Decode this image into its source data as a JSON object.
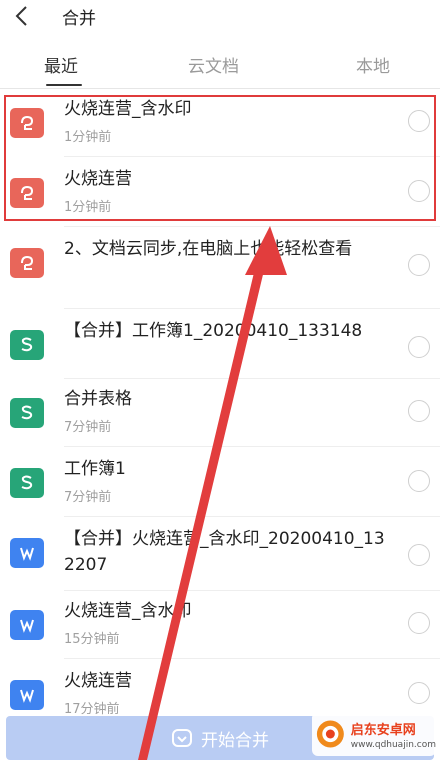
{
  "header": {
    "title": "合并",
    "back_icon": "chevron-left-icon"
  },
  "tabs": [
    {
      "label": "最近",
      "active": true
    },
    {
      "label": "云文档",
      "active": false
    },
    {
      "label": "本地",
      "active": false
    }
  ],
  "files": [
    {
      "name": "火烧连营_含水印",
      "time": "1分钟前",
      "type": "pdf"
    },
    {
      "name": "火烧连营",
      "time": "1分钟前",
      "type": "pdf"
    },
    {
      "name": "2、文档云同步,在电脑上也能轻松查看",
      "time": "",
      "type": "pdf"
    },
    {
      "name": "【合并】工作簿1_20200410_133148",
      "time": "",
      "type": "sheet"
    },
    {
      "name": "合并表格",
      "time": "7分钟前",
      "type": "sheet"
    },
    {
      "name": "工作簿1",
      "time": "7分钟前",
      "type": "sheet"
    },
    {
      "name": "【合并】火烧连营_含水印_20200410_132207",
      "time": "",
      "type": "doc"
    },
    {
      "name": "火烧连营_含水印",
      "time": "15分钟前",
      "type": "doc"
    },
    {
      "name": "火烧连营",
      "time": "17分钟前",
      "type": "doc"
    }
  ],
  "bottom": {
    "button_label": "开始合并"
  },
  "watermark": {
    "name": "启东安卓网",
    "url": "www.qdhuajin.com"
  },
  "colors": {
    "pdf": "#e8665a",
    "sheet": "#27a578",
    "doc": "#3f83f0",
    "highlight": "#e03b3b",
    "button_bg": "#b9ccf3"
  }
}
